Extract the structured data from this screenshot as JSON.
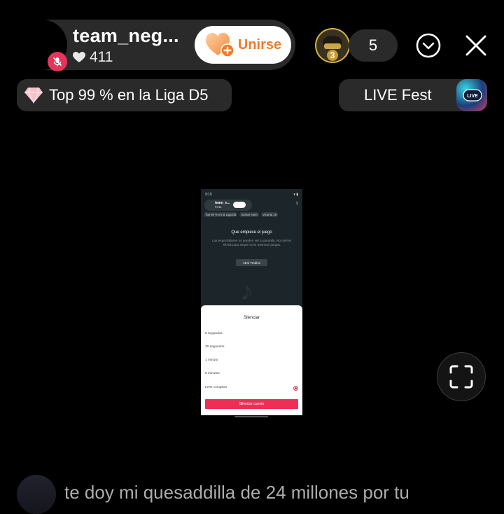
{
  "host": {
    "name": "team_neg...",
    "likes": "411",
    "join_label": "Unirse"
  },
  "viewers": {
    "badge_number": "3",
    "count": "5"
  },
  "league": {
    "text": "Top 99 % en la Liga D5"
  },
  "live_fest": {
    "label": "LIVE Fest",
    "badge_text": "LIVE"
  },
  "shared_screen": {
    "status_time": "9:15",
    "host_name": "team_n...",
    "host_likes": "411",
    "top_right": "5",
    "pills": [
      "Top 99 % en la Liga D5",
      "Sumar etom",
      "Victoria 19"
    ],
    "game_title": "Que empiece el juego",
    "game_text": "Los espectadores no pueden ver tu pantalla. No cierres TikTok para seguir LIVE mientras juegas.",
    "game_button": "Abrir Roblox",
    "sheet": {
      "title": "Silenciar",
      "options": [
        "5 segundos",
        "30 segundos",
        "1 minuto",
        "5 minutos",
        "LIVE completo"
      ],
      "confirm_button": "Silenciar cuenta"
    }
  },
  "comment": {
    "text": "te doy mi quesaddilla de 24 millones por tu"
  },
  "colors": {
    "accent_pink": "#e6355a",
    "join_orange": "#ee7b2c",
    "pill_bg": "#2a2a2a"
  }
}
